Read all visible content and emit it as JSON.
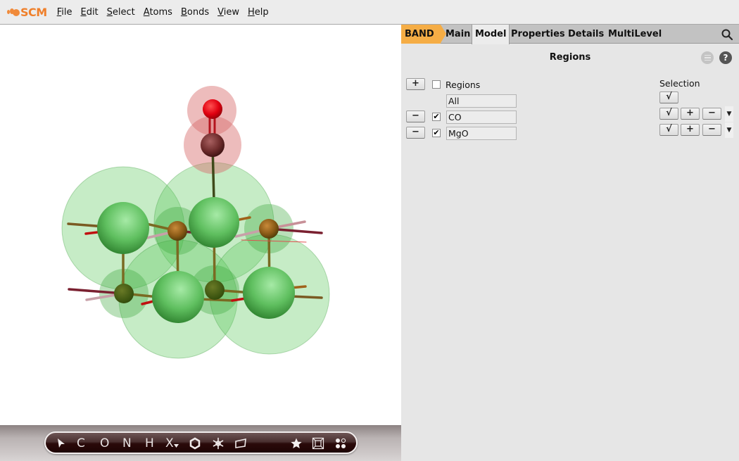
{
  "app": {
    "logo_text": "SCM",
    "brand_color": "#ef7f2a"
  },
  "menubar": {
    "items": [
      {
        "label_ul": "F",
        "label_rest": "ile"
      },
      {
        "label_ul": "E",
        "label_rest": "dit"
      },
      {
        "label_ul": "S",
        "label_rest": "elect"
      },
      {
        "label_ul": "A",
        "label_rest": "toms"
      },
      {
        "label_ul": "B",
        "label_rest": "onds"
      },
      {
        "label_ul": "V",
        "label_rest": "iew"
      },
      {
        "label_ul": "H",
        "label_rest": "elp"
      }
    ]
  },
  "viewport": {
    "molecule": "CO adsorbed on MgO slab",
    "region_colors": {
      "CO": "#e88080",
      "MgO": "#7fd67f"
    }
  },
  "toolbar": {
    "buttons": [
      {
        "name": "select-pointer",
        "glyph": "pointer-icon"
      },
      {
        "name": "carbon",
        "label": "C"
      },
      {
        "name": "oxygen",
        "label": "O"
      },
      {
        "name": "nitrogen",
        "label": "N"
      },
      {
        "name": "hydrogen",
        "label": "H"
      },
      {
        "name": "other-element",
        "label": "X"
      },
      {
        "name": "ring",
        "glyph": "hexagon-icon"
      },
      {
        "name": "structures",
        "glyph": "snowflake-icon"
      },
      {
        "name": "plane",
        "glyph": "plane-icon"
      },
      {
        "name": "favorites",
        "glyph": "star-icon"
      },
      {
        "name": "crystal",
        "glyph": "cube-icon"
      },
      {
        "name": "more",
        "glyph": "dots-icon"
      }
    ]
  },
  "panel": {
    "tabs": [
      {
        "label": "BAND",
        "state": "engine",
        "color": "#f5ad45"
      },
      {
        "label": "Main",
        "state": "inactive"
      },
      {
        "label": "Model",
        "state": "active"
      },
      {
        "label": "Properties",
        "state": "inactive"
      },
      {
        "label": "Details",
        "state": "inactive"
      },
      {
        "label": "MultiLevel",
        "state": "inactive"
      }
    ],
    "title": "Regions",
    "help_label": "?",
    "regions_header": {
      "add_label": "+",
      "checked": false,
      "label": "Regions"
    },
    "selection_header": "Selection",
    "all_row": {
      "name": "All",
      "select_label": "√"
    },
    "regions": [
      {
        "remove_label": "−",
        "checked": true,
        "check_mark": "✔",
        "name": "CO",
        "select_label": "√",
        "add_label": "+",
        "minus_label": "−",
        "dropdown": "▼"
      },
      {
        "remove_label": "−",
        "checked": true,
        "check_mark": "✔",
        "name": "MgO",
        "select_label": "√",
        "add_label": "+",
        "minus_label": "−",
        "dropdown": "▼"
      }
    ]
  }
}
